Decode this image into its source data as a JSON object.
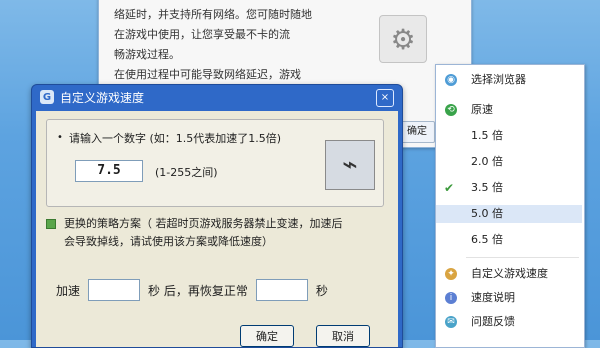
{
  "background_window": {
    "lines": [
      "络延时，并支持所有网络。您可随时随地",
      "在游戏中使用，让您享受最不卡的流",
      "畅游戏过程。",
      "在使用过程中可能导致网络延迟，游戏"
    ],
    "ok_label": "确定"
  },
  "dialog": {
    "title": "自定义游戏速度",
    "close_label": "×",
    "prompt": "请输入一个数字 (如：1.5代表加速了1.5倍)",
    "speed_value": "7.5",
    "range_hint": "(1-255之间)",
    "advanced_text_1": "更换的策略方案（ 若超时页游戏服务器禁止变速，加速后",
    "advanced_text_2": "会导致掉线，请试使用该方案或降低速度）",
    "timer_prefix": "加速",
    "timer_middle": "秒 后，再恢复正常",
    "timer_suffix": "秒",
    "ok_label": "确定",
    "cancel_label": "取消"
  },
  "menu": {
    "items": [
      {
        "label": "选择浏览器",
        "icon": "browser-icon"
      },
      {
        "label": "原速",
        "icon": "reset-icon"
      },
      {
        "label": "1.5 倍"
      },
      {
        "label": "2.0 倍"
      },
      {
        "label": "3.5 倍",
        "checked": true
      },
      {
        "label": "5.0 倍",
        "selected": true
      },
      {
        "label": "6.5 倍"
      },
      {
        "label": "自定义游戏速度",
        "icon": "custom-icon"
      },
      {
        "label": "速度说明",
        "icon": "info-icon"
      },
      {
        "label": "问题反馈",
        "icon": "feedback-icon"
      }
    ]
  },
  "colors": {
    "title_bar": "#2f69c8",
    "menu_selected": "#dbe7f7",
    "check": "#3c9a3c"
  }
}
